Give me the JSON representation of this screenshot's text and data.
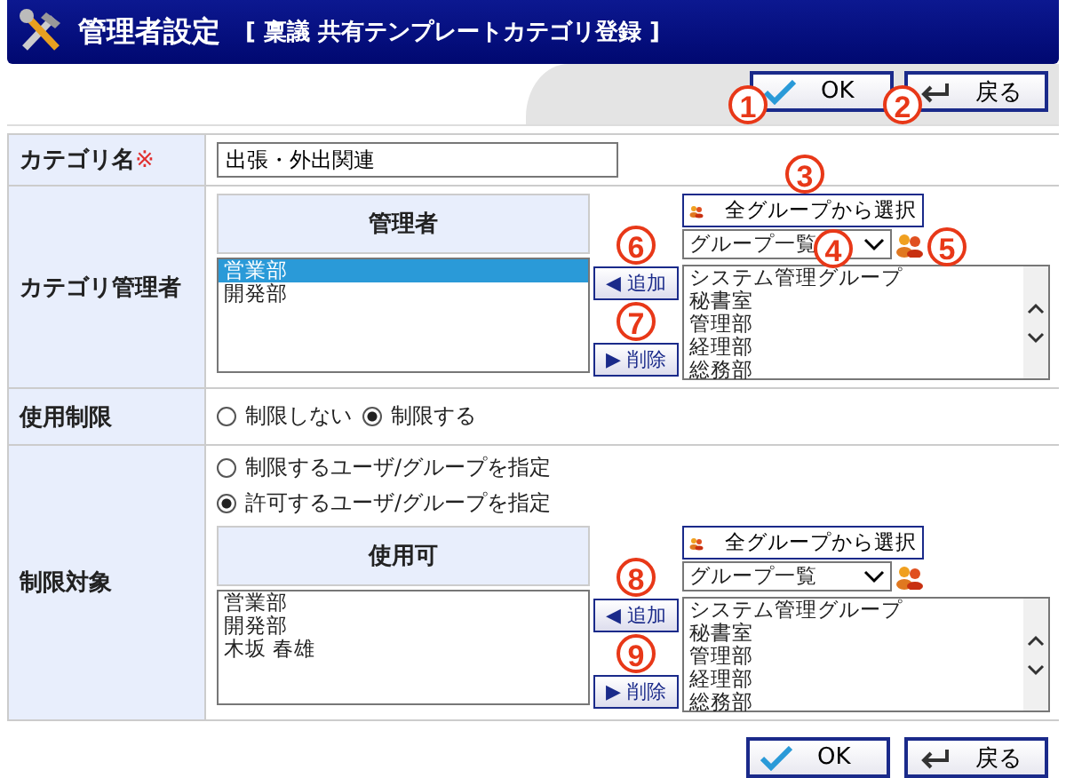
{
  "header": {
    "title": "管理者設定",
    "subtitle": "[ 稟議 共有テンプレートカテゴリ登録 ]"
  },
  "top_buttons": [
    {
      "kind": "ok",
      "label": "OK",
      "callout": "1"
    },
    {
      "kind": "back",
      "label": "戻る",
      "callout": "2"
    }
  ],
  "category_name": {
    "label": "カテゴリ名",
    "required_mark": "※",
    "value": "出張・外出関連"
  },
  "category_admin": {
    "label": "カテゴリ管理者",
    "picker": {
      "heading": "管理者",
      "selected_items": [
        {
          "label": "営業部",
          "selected": true
        },
        {
          "label": "開発部",
          "selected": false
        }
      ],
      "add_button": {
        "arrow": "◀",
        "label": "追加",
        "callout": "6"
      },
      "remove_button": {
        "arrow": "▶",
        "label": "削除",
        "callout": "7"
      },
      "all_groups_button": {
        "label": "全グループから選択",
        "callout": "3"
      },
      "group_select": {
        "value": "グループ一覧",
        "callout": "4"
      },
      "group_icon_callout": "5",
      "available_items": [
        "システム管理グループ",
        "秘書室",
        "管理部",
        "経理部",
        "総務部"
      ]
    }
  },
  "usage_limit": {
    "label": "使用制限",
    "options": [
      {
        "label": "制限しない",
        "selected": false
      },
      {
        "label": "制限する",
        "selected": true
      }
    ]
  },
  "restriction_target": {
    "label": "制限対象",
    "options": [
      {
        "label": "制限するユーザ/グループを指定",
        "selected": false
      },
      {
        "label": "許可するユーザ/グループを指定",
        "selected": true
      }
    ],
    "picker": {
      "heading": "使用可",
      "selected_items": [
        {
          "label": "営業部",
          "selected": false
        },
        {
          "label": "開発部",
          "selected": false
        },
        {
          "label": "木坂 春雄",
          "selected": false
        }
      ],
      "add_button": {
        "arrow": "◀",
        "label": "追加",
        "callout": "8"
      },
      "remove_button": {
        "arrow": "▶",
        "label": "削除",
        "callout": "9"
      },
      "all_groups_button": {
        "label": "全グループから選択"
      },
      "group_select": {
        "value": "グループ一覧"
      },
      "available_items": [
        "システム管理グループ",
        "秘書室",
        "管理部",
        "経理部",
        "総務部"
      ]
    }
  },
  "bottom_buttons": [
    {
      "kind": "ok",
      "label": "OK"
    },
    {
      "kind": "back",
      "label": "戻る"
    }
  ]
}
